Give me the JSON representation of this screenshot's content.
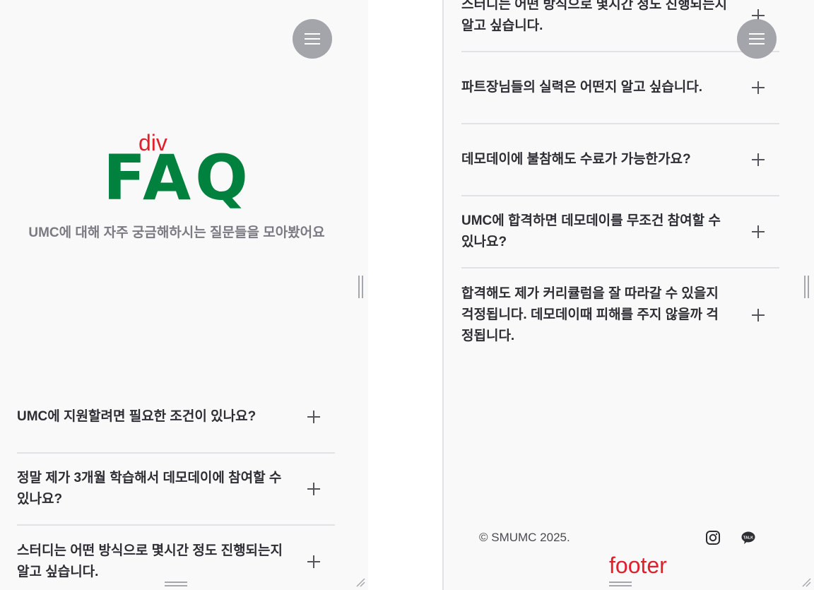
{
  "left_panel": {
    "annotation": "div",
    "title": "FAQ",
    "subtitle": "UMC에 대해 자주 궁금해하시는 질문들을 모아봤어요",
    "faq": [
      {
        "question": "UMC에 지원할려면 필요한 조건이 있나요?"
      },
      {
        "question": "정말 제가 3개월 학습해서 데모데이에 참여할 수 있나요?"
      },
      {
        "question": "스터디는 어떤 방식으로 몇시간 정도 진행되는지 알고 싶습니다."
      }
    ]
  },
  "right_panel": {
    "faq": [
      {
        "question": "스터디는 어떤 방식으로 몇시간 정도 진행되는지 알고 싶습니다."
      },
      {
        "question": "파트장님들의 실력은 어떤지 알고 싶습니다."
      },
      {
        "question": "데모데이에 불참해도 수료가 가능한가요?"
      },
      {
        "question": "UMC에 합격하면 데모데이를 무조건 참여할 수 있나요?"
      },
      {
        "question": "합격해도 제가 커리큘럼을 잘 따라갈 수 있을지 걱정됩니다. 데모데이때 피해를 주지 않을까 걱정됩니다."
      }
    ],
    "footer": {
      "copyright": "© SMUMC 2025.",
      "instagram_icon": "instagram-icon",
      "kakaotalk_icon": "kakaotalk-icon",
      "kakaotalk_text": "TALK"
    },
    "annotation": "footer"
  },
  "colors": {
    "brand_green": "#00813e",
    "annotation_red": "#e0202a",
    "menu_button": "#a3a5ab",
    "panel_bg": "#f9f9fa"
  },
  "icons": {
    "menu": "hamburger-menu-icon",
    "expand": "plus-icon"
  }
}
